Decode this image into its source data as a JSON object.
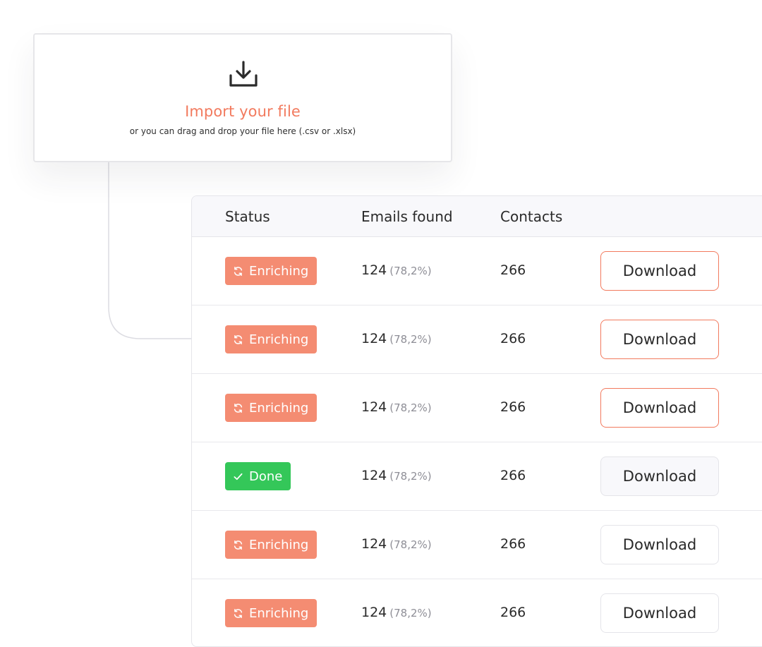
{
  "import": {
    "title": "Import your file",
    "subtitle": "or you can drag and drop your file here (.csv or .xlsx)",
    "icon": "download-tray-icon"
  },
  "table": {
    "headers": {
      "status": "Status",
      "emails": "Emails found",
      "contacts": "Contacts"
    },
    "rows": [
      {
        "status": "Enriching",
        "state": "enriching",
        "emails": "124",
        "pct": "(78,2%)",
        "contacts": "266",
        "action": "Download",
        "button_style": "highlighted"
      },
      {
        "status": "Enriching",
        "state": "enriching",
        "emails": "124",
        "pct": "(78,2%)",
        "contacts": "266",
        "action": "Download",
        "button_style": "highlighted"
      },
      {
        "status": "Enriching",
        "state": "enriching",
        "emails": "124",
        "pct": "(78,2%)",
        "contacts": "266",
        "action": "Download",
        "button_style": "highlighted"
      },
      {
        "status": "Done",
        "state": "done",
        "emails": "124",
        "pct": "(78,2%)",
        "contacts": "266",
        "action": "Download",
        "button_style": "muted"
      },
      {
        "status": "Enriching",
        "state": "enriching",
        "emails": "124",
        "pct": "(78,2%)",
        "contacts": "266",
        "action": "Download",
        "button_style": "default"
      },
      {
        "status": "Enriching",
        "state": "enriching",
        "emails": "124",
        "pct": "(78,2%)",
        "contacts": "266",
        "action": "Download",
        "button_style": "default"
      }
    ]
  },
  "colors": {
    "accent": "#f27a5e",
    "enriching_badge": "#f48c72",
    "done_badge": "#34c759"
  },
  "icons": {
    "enriching": "refresh-icon",
    "done": "check-icon"
  }
}
